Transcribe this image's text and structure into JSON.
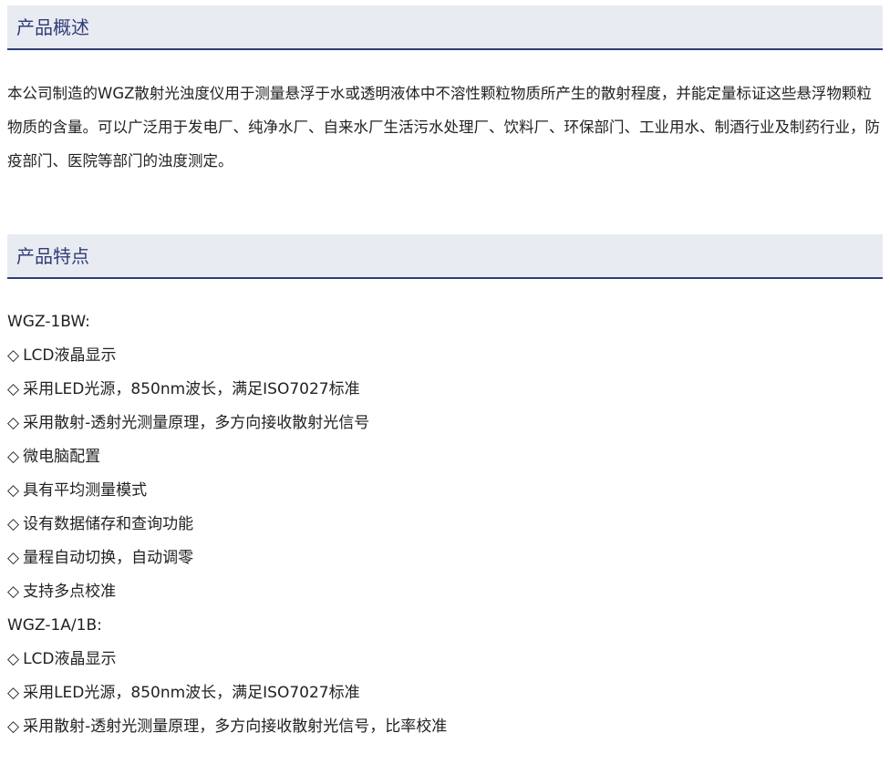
{
  "overview": {
    "title": "产品概述",
    "text": "本公司制造的WGZ散射光浊度仪用于测量悬浮于水或透明液体中不溶性颗粒物质所产生的散射程度，并能定量标证这些悬浮物颗粒物质的含量。可以广泛用于发电厂、纯净水厂、自来水厂生活污水处理厂、饮料厂、环保部门、工业用水、制酒行业及制药行业，防疫部门、医院等部门的浊度测定。"
  },
  "features": {
    "title": "产品特点",
    "bullet_glyph": "◇",
    "groups": [
      {
        "model": "WGZ-1BW:",
        "items": [
          "LCD液晶显示",
          "采用LED光源，850nm波长，满足ISO7027标准",
          "采用散射-透射光测量原理，多方向接收散射光信号",
          "微电脑配置",
          "具有平均测量模式",
          "设有数据储存和查询功能",
          "量程自动切换，自动调零",
          "支持多点校准"
        ]
      },
      {
        "model": "WGZ-1A/1B:",
        "items": [
          "LCD液晶显示",
          "采用LED光源，850nm波长，满足ISO7027标准",
          "采用散射-透射光测量原理，多方向接收散射光信号，比率校准"
        ]
      }
    ]
  }
}
